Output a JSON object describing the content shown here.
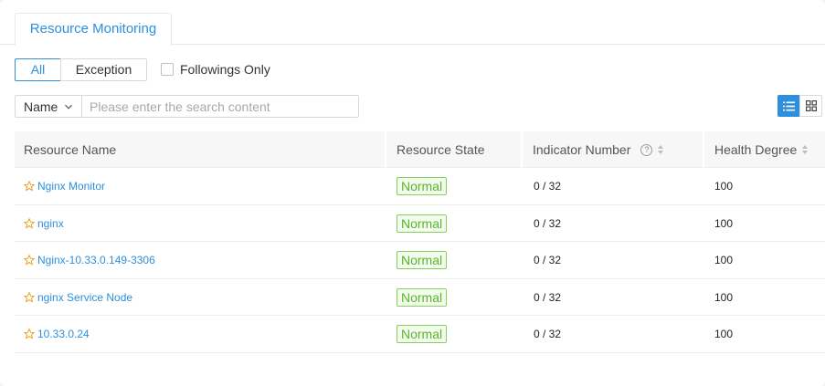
{
  "tabs": {
    "active_label": "Resource Monitoring"
  },
  "filters": {
    "segments": [
      "All",
      "Exception"
    ],
    "followings_label": "Followings Only"
  },
  "search": {
    "field_label": "Name",
    "placeholder": "Please enter the search content"
  },
  "view_toggle": {
    "active": "list-view",
    "icons": [
      "list-icon",
      "grid-icon"
    ]
  },
  "table": {
    "headers": {
      "name": "Resource Name",
      "state": "Resource State",
      "indicator": "Indicator Number",
      "health": "Health Degree"
    },
    "rows": [
      {
        "name": "Nginx Monitor",
        "state": "Normal",
        "indicator": "0 / 32",
        "health": "100"
      },
      {
        "name": "nginx",
        "state": "Normal",
        "indicator": "0 / 32",
        "health": "100"
      },
      {
        "name": "Nginx-10.33.0.149-3306",
        "state": "Normal",
        "indicator": "0 / 32",
        "health": "100"
      },
      {
        "name": "nginx Service Node",
        "state": "Normal",
        "indicator": "0 / 32",
        "health": "100"
      },
      {
        "name": "10.33.0.24",
        "state": "Normal",
        "indicator": "0 / 32",
        "health": "100"
      }
    ]
  },
  "colors": {
    "accent": "#2f8fdc",
    "normal_text": "#5ab42e",
    "normal_border": "#86cf5f",
    "star": "#f0a020"
  }
}
